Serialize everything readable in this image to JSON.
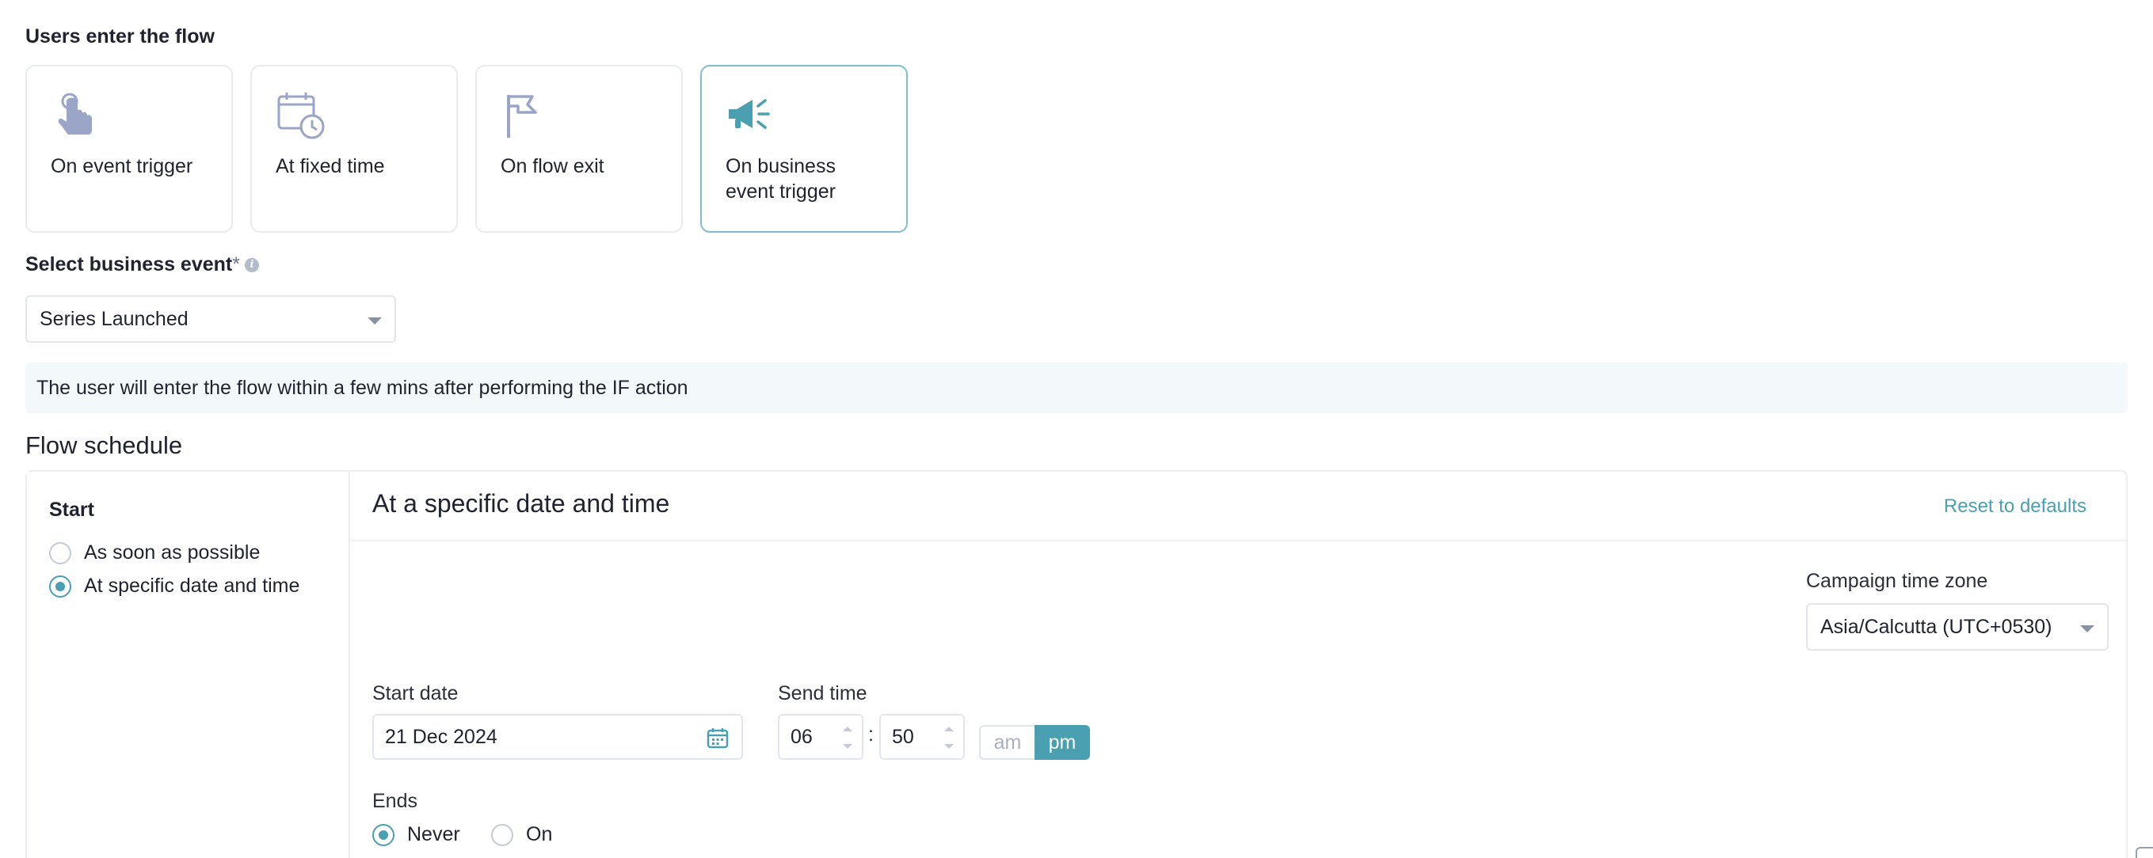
{
  "entry": {
    "heading": "Users enter the flow",
    "cards": [
      {
        "label": "On event trigger",
        "icon": "pointer-hand-icon",
        "selected": false
      },
      {
        "label": "At fixed time",
        "icon": "calendar-clock-icon",
        "selected": false
      },
      {
        "label": "On flow exit",
        "icon": "flag-icon",
        "selected": false
      },
      {
        "label": "On business event trigger",
        "icon": "megaphone-icon",
        "selected": true
      }
    ]
  },
  "business_event": {
    "label": "Select business event",
    "required_mark": "*",
    "info_icon": "info-icon",
    "value": "Series Launched"
  },
  "info_banner": "The user will enter the flow within a few mins after performing the IF action",
  "flow_schedule": {
    "title": "Flow schedule",
    "start": {
      "heading": "Start",
      "options": [
        {
          "label": "As soon as possible",
          "selected": false
        },
        {
          "label": "At specific date and time",
          "selected": true
        }
      ]
    },
    "detail": {
      "title": "At a specific date and time",
      "reset_label": "Reset to defaults",
      "timezone_label": "Campaign time zone",
      "timezone_value": "Asia/Calcutta (UTC+0530)",
      "start_date_label": "Start date",
      "start_date_value": "21 Dec 2024",
      "send_time_label": "Send time",
      "hour": "06",
      "colon": ":",
      "minute": "50",
      "am_label": "am",
      "pm_label": "pm",
      "period_selected": "pm",
      "ends_label": "Ends",
      "ends_options": [
        {
          "label": "Never",
          "selected": true
        },
        {
          "label": "On",
          "selected": false
        }
      ]
    }
  },
  "colors": {
    "accent": "#4a9fb0",
    "icon_muted": "#9aa5c7",
    "icon_active": "#4a9fb0"
  }
}
